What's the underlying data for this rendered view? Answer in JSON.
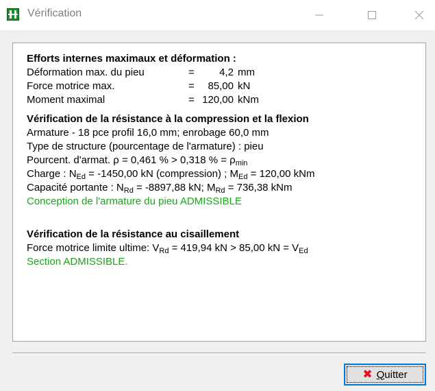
{
  "window": {
    "title": "Vérification",
    "icon": "geo5-app-icon",
    "controls": [
      "minimize-icon",
      "maximize-icon",
      "close-icon"
    ]
  },
  "section1": {
    "heading": "Efforts internes maximaux et déformation :",
    "rows": [
      {
        "label": "Déformation max. du pieu",
        "eq": "=",
        "value": "4,2",
        "unit": "mm"
      },
      {
        "label": "Force motrice max.",
        "eq": "=",
        "value": "85,00",
        "unit": "kN"
      },
      {
        "label": "Moment maximal",
        "eq": "=",
        "value": "120,00",
        "unit": "kNm"
      }
    ]
  },
  "section2": {
    "heading": "Vérification de la résistance à la compression et la flexion",
    "armature": "Armature - 18 pce profil 16,0 mm; enrobage 60,0 mm",
    "structure": "Type de structure (pourcentage de l'armature) : pieu",
    "pourcent": {
      "prefix": "Pourcent. d'armat. ρ = 0,461 % > 0,318 % = ρ",
      "sub": "min"
    },
    "charge": {
      "prefix": "Charge : N",
      "sub1": "Ed",
      "mid": " = -1450,00 kN (compression) ; M",
      "sub2": "Ed",
      "suffix": " = 120,00 kNm"
    },
    "capacite": {
      "prefix": "Capacité portante : N",
      "sub1": "Rd",
      "mid": " = -8897,88 kN; M",
      "sub2": "Rd",
      "suffix": " = 736,38 kNm"
    },
    "result": "Conception de l'armature du pieu ADMISSIBLE"
  },
  "section3": {
    "heading": "Vérification de la résistance au cisaillement",
    "line": {
      "prefix": "Force motrice limite ultime: V",
      "sub1": "Rd",
      "mid": " = 419,94 kN > 85,00 kN = V",
      "sub2": "Ed"
    },
    "result": "Section ADMISSIBLE."
  },
  "footer": {
    "quit_label_first": "Q",
    "quit_label_rest": "uitter",
    "quit_icon": "red-x-icon"
  },
  "colors": {
    "ok_green": "#1aa51a",
    "quit_x_red": "#e81123",
    "focus_border": "#0078d7"
  }
}
